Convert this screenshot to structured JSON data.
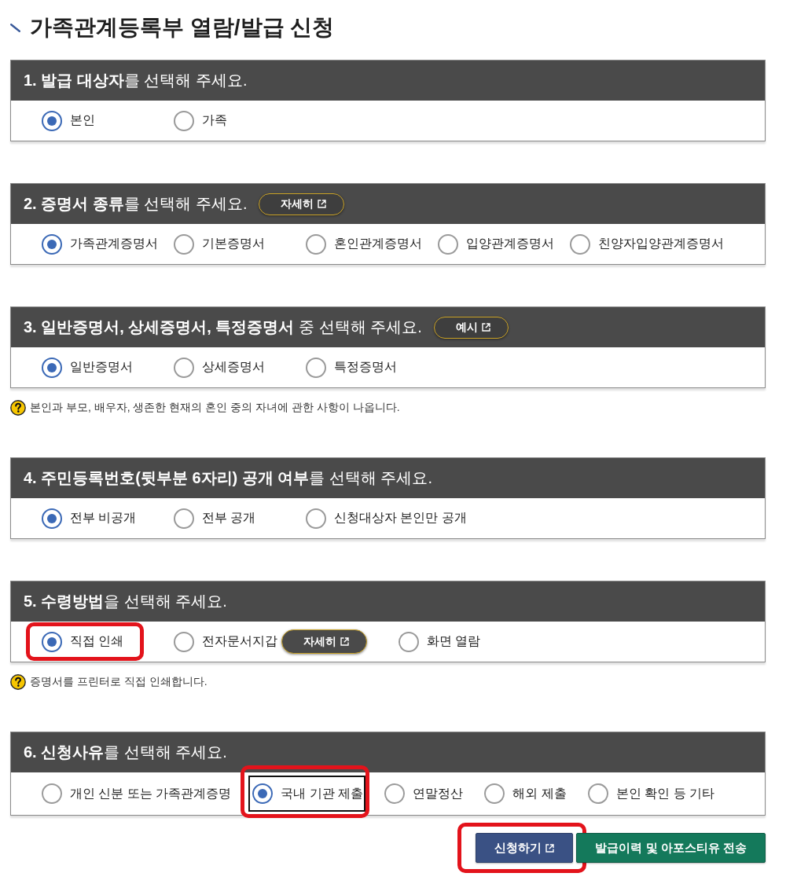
{
  "page_title": "가족관계등록부 열람/발급 신청",
  "sections": [
    {
      "heading": "**1. 발급 대상자**를 선택해 주세요.",
      "options": [
        {
          "label": "본인",
          "selected": true
        },
        {
          "label": "가족",
          "selected": false
        }
      ]
    },
    {
      "heading": "**2. 증명서 종류**를 선택해 주세요.",
      "heading_button": "자세히",
      "options": [
        {
          "label": "가족관계증명서",
          "selected": true
        },
        {
          "label": "기본증명서",
          "selected": false
        },
        {
          "label": "혼인관계증명서",
          "selected": false
        },
        {
          "label": "입양관계증명서",
          "selected": false
        },
        {
          "label": "친양자입양관계증명서",
          "selected": false
        }
      ]
    },
    {
      "heading": "**3. 일반증명서, 상세증명서, 특정증명서** 중 선택해 주세요.",
      "heading_button": "예시",
      "options": [
        {
          "label": "일반증명서",
          "selected": true
        },
        {
          "label": "상세증명서",
          "selected": false
        },
        {
          "label": "특정증명서",
          "selected": false
        }
      ],
      "note": "본인과 부모, 배우자, 생존한 현재의 혼인 중의 자녀에 관한 사항이 나옵니다."
    },
    {
      "heading": "**4. 주민등록번호(뒷부분 6자리) 공개 여부**를 선택해 주세요.",
      "options": [
        {
          "label": "전부 비공개",
          "selected": true
        },
        {
          "label": "전부 공개",
          "selected": false
        },
        {
          "label": "신청대상자 본인만 공개",
          "selected": false
        }
      ]
    },
    {
      "heading": "**5. 수령방법**을 선택해 주세요.",
      "options": [
        {
          "label": "직접 인쇄",
          "selected": true,
          "highlighted": true
        },
        {
          "label": "전자문서지갑",
          "selected": false,
          "highlighted": false,
          "detail_button": "자세히"
        },
        {
          "label": "화면 열람",
          "selected": false,
          "highlighted": false
        }
      ],
      "note": "증명서를 프린터로 직접 인쇄합니다."
    },
    {
      "heading": "**6. 신청사유**를 선택해 주세요.",
      "options": [
        {
          "label": "개인 신분 또는 가족관계증명",
          "selected": false,
          "focused": false,
          "highlighted": false
        },
        {
          "label": "국내 기관 제출",
          "selected": true,
          "focused": true,
          "highlighted": true
        },
        {
          "label": "연말정산",
          "selected": false,
          "focused": false,
          "highlighted": false
        },
        {
          "label": "해외 제출",
          "selected": false,
          "focused": false,
          "highlighted": false
        },
        {
          "label": "본인 확인 등 기타",
          "selected": false,
          "focused": false,
          "highlighted": false
        }
      ]
    }
  ],
  "buttons": [
    {
      "kind": "primary",
      "label": "신청하기",
      "external_link": true,
      "highlighted": true
    },
    {
      "kind": "secondary",
      "label": "발급이력 및 아포스티유 전송",
      "external_link": false,
      "highlighted": false
    }
  ]
}
